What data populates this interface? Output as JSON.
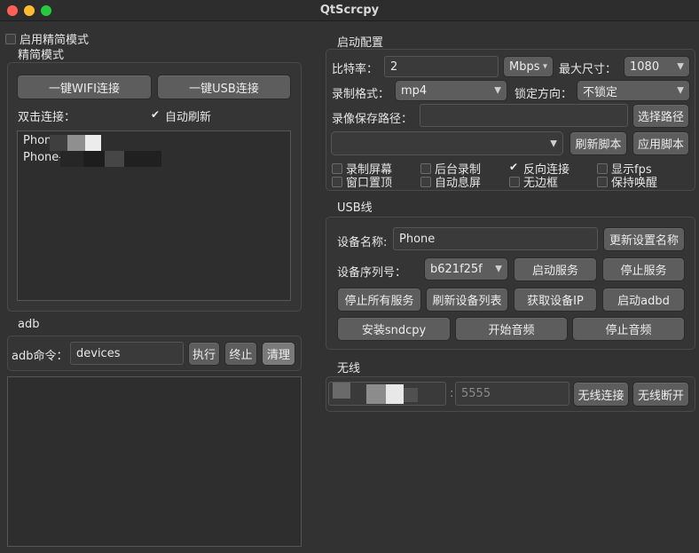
{
  "window": {
    "title": "QtScrcpy"
  },
  "simple_mode": {
    "checkbox_label": "启用精简模式",
    "checked": false,
    "group_title": "精简模式",
    "wifi_button": "一键WIFI连接",
    "usb_button": "一键USB连接",
    "double_click_label": "双击连接：",
    "auto_refresh_label": "自动刷新",
    "auto_refresh_checked": true,
    "devices": [
      "Phon",
      "Phone-"
    ]
  },
  "adb": {
    "group_title": "adb",
    "command_label": "adb命令：",
    "command_value": "devices",
    "execute_button": "执行",
    "stop_button": "终止",
    "clear_button": "清理"
  },
  "launch_config": {
    "group_title": "启动配置",
    "bitrate_label": "比特率：",
    "bitrate_value": "2",
    "bitrate_unit": "Mbps",
    "max_size_label": "最大尺寸：",
    "max_size_value": "1080",
    "record_format_label": "录制格式：",
    "record_format_value": "mp4",
    "lock_orientation_label": "锁定方向：",
    "lock_orientation_value": "不锁定",
    "record_path_label": "录像保存路径：",
    "record_path_value": "",
    "select_path_button": "选择路径",
    "script_value": "",
    "refresh_script_button": "刷新脚本",
    "apply_script_button": "应用脚本",
    "options": [
      {
        "label": "录制屏幕",
        "checked": false
      },
      {
        "label": "后台录制",
        "checked": false
      },
      {
        "label": "反向连接",
        "checked": true
      },
      {
        "label": "显示fps",
        "checked": false
      },
      {
        "label": "窗口置顶",
        "checked": false
      },
      {
        "label": "自动息屏",
        "checked": false
      },
      {
        "label": "无边框",
        "checked": false
      },
      {
        "label": "保持唤醒",
        "checked": false
      }
    ]
  },
  "usb": {
    "group_title": "USB线",
    "device_name_label": "设备名称:",
    "device_name_value": "Phone",
    "update_name_button": "更新设置名称",
    "serial_label": "设备序列号：",
    "serial_value": "b621f25f",
    "start_service_button": "启动服务",
    "stop_service_button": "停止服务",
    "stop_all_button": "停止所有服务",
    "refresh_devices_button": "刷新设备列表",
    "get_ip_button": "获取设备IP",
    "start_adbd_button": "启动adbd",
    "install_sndcpy_button": "安装sndcpy",
    "start_audio_button": "开始音频",
    "stop_audio_button": "停止音频"
  },
  "wireless": {
    "group_title": "无线",
    "ip_value": "",
    "separator": ":",
    "port_placeholder": "5555",
    "connect_button": "无线连接",
    "disconnect_button": "无线断开"
  },
  "colors": {
    "background": "#323232",
    "button": "#5d5d5d",
    "close": "#ff5f57",
    "minimize": "#febc2e",
    "maximize": "#28c840"
  }
}
